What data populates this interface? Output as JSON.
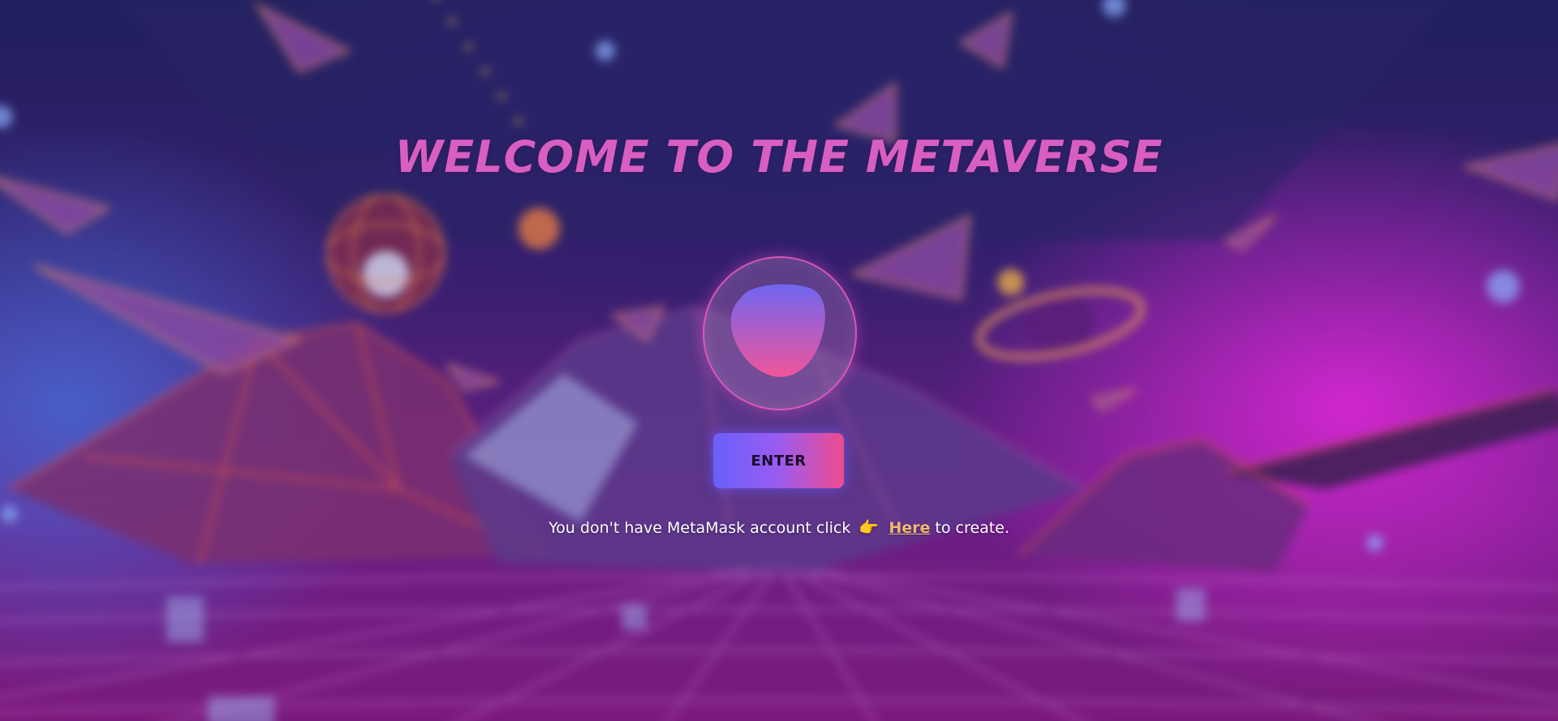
{
  "page": {
    "title": "WELCOME TO THE METAVERSE",
    "background_icon": "metaverse-scene-background",
    "accent_color": "#d85fc1"
  },
  "logo": {
    "icon": "metamask-blob-icon",
    "gradient_top": "#6f66f0",
    "gradient_bottom": "#f0559a"
  },
  "enter_button": {
    "label": "ENTER",
    "gradient_start": "#6a5ffb",
    "gradient_end": "#ee4c8f"
  },
  "hint": {
    "prefix": "You don't have MetaMask account click",
    "pointer_icon": "pointing-hand-icon",
    "pointer_glyph": "👉",
    "link_label": "Here",
    "suffix": "to create."
  }
}
